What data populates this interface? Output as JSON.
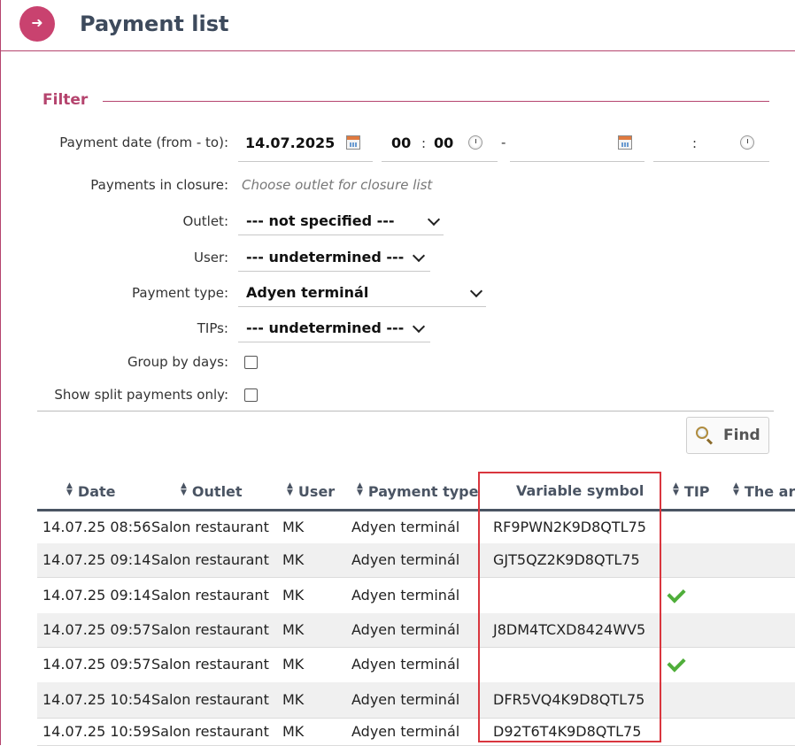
{
  "header": {
    "title": "Payment list",
    "back_icon": "arrow-right-icon"
  },
  "filter": {
    "title": "Filter",
    "payment_date_label": "Payment date (from - to):",
    "date_from": "14.07.2025",
    "time_from_h": "00",
    "time_from_m": "00",
    "time_colon": ":",
    "range_dash": "-",
    "date_to": "",
    "time_to_colon": ":",
    "closure_label": "Payments in closure:",
    "closure_placeholder": "Choose outlet for closure list",
    "outlet_label": "Outlet:",
    "outlet_value": "--- not specified ---",
    "user_label": "User:",
    "user_value": "--- undetermined ---",
    "payment_type_label": "Payment type:",
    "payment_type_value": "Adyen terminál",
    "tips_label": "TIPs:",
    "tips_value": "--- undetermined ---",
    "group_by_days_label": "Group by days:",
    "split_only_label": "Show split payments only:",
    "find_label": "Find"
  },
  "table": {
    "columns": [
      "Date",
      "Outlet",
      "User",
      "Payment type",
      "Variable symbol",
      "TIP",
      "The ar"
    ],
    "rows": [
      {
        "date": "14.07.25 08:56",
        "outlet": "Salon restaurant",
        "user": "MK",
        "payment_type": "Adyen terminál",
        "variable_symbol": "RF9PWN2K9D8QTL75",
        "tip": false
      },
      {
        "date": "14.07.25 09:14",
        "outlet": "Salon restaurant",
        "user": "MK",
        "payment_type": "Adyen terminál",
        "variable_symbol": "GJT5QZ2K9D8QTL75",
        "tip": false
      },
      {
        "date": "14.07.25 09:14",
        "outlet": "Salon restaurant",
        "user": "MK",
        "payment_type": "Adyen terminál",
        "variable_symbol": "",
        "tip": true
      },
      {
        "date": "14.07.25 09:57",
        "outlet": "Salon restaurant",
        "user": "MK",
        "payment_type": "Adyen terminál",
        "variable_symbol": "J8DM4TCXD8424WV5",
        "tip": false
      },
      {
        "date": "14.07.25 09:57",
        "outlet": "Salon restaurant",
        "user": "MK",
        "payment_type": "Adyen terminál",
        "variable_symbol": "",
        "tip": true
      },
      {
        "date": "14.07.25 10:54",
        "outlet": "Salon restaurant",
        "user": "MK",
        "payment_type": "Adyen terminál",
        "variable_symbol": "DFR5VQ4K9D8QTL75",
        "tip": false
      },
      {
        "date": "14.07.25 10:59",
        "outlet": "Salon restaurant",
        "user": "MK",
        "payment_type": "Adyen terminál",
        "variable_symbol": "D92T6T4K9D8QTL75",
        "tip": false
      }
    ]
  },
  "colors": {
    "accent": "#b5446e",
    "button": "#c9426f",
    "highlight": "#d9363e",
    "tip_check": "#4fae3a"
  }
}
